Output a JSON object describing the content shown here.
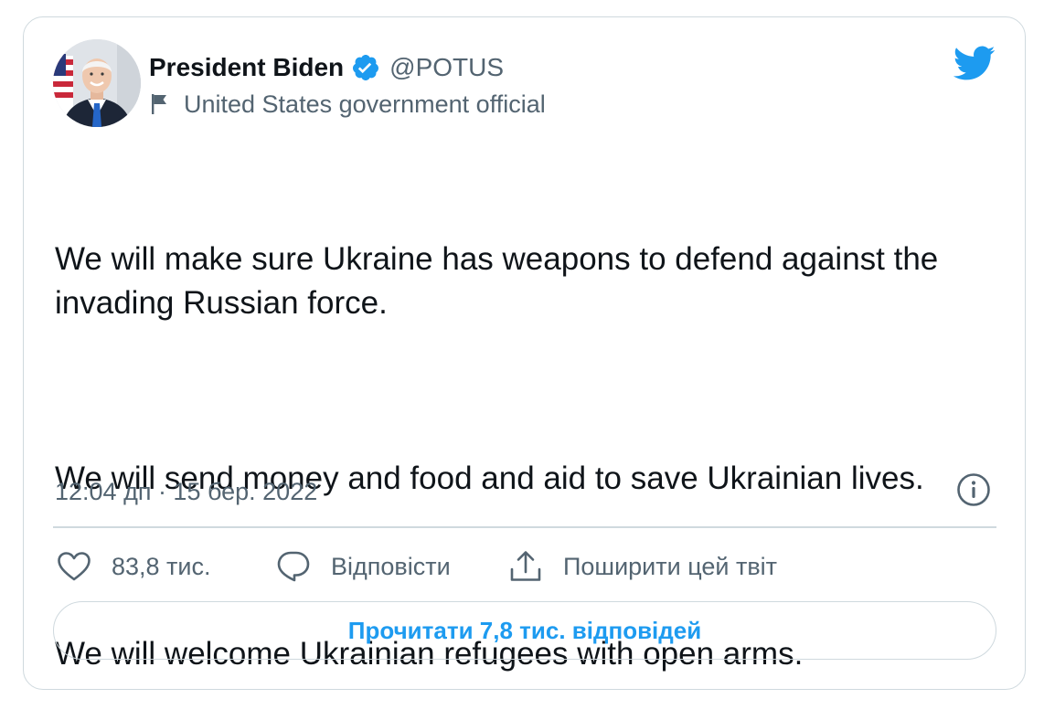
{
  "author": {
    "display_name": "President Biden",
    "handle": "@POTUS",
    "label": "United States government official",
    "avatar_icon": "avatar-photo",
    "verified_icon": "verified-badge-icon",
    "label_icon": "flag-icon"
  },
  "brand": {
    "logo_icon": "twitter-bird-icon",
    "accent_color": "#1d9bf0"
  },
  "tweet": {
    "paragraphs": [
      "We will make sure Ukraine has weapons to defend against the invading Russian force.",
      "We will send money and food and aid to save Ukrainian lives.",
      "We will welcome Ukrainian refugees with open arms."
    ],
    "timestamp": "12:04 дп · 15 бер. 2022"
  },
  "actions": {
    "like": {
      "icon": "heart-icon",
      "label": "83,8 тис."
    },
    "reply": {
      "icon": "speech-bubble-icon",
      "label": "Відповісти"
    },
    "share": {
      "icon": "share-icon",
      "label": "Поширити цей твіт"
    },
    "info_icon": "info-icon"
  },
  "footer": {
    "read_replies_label": "Прочитати 7,8 тис. відповідей"
  },
  "colors": {
    "text_primary": "#0f1419",
    "text_secondary": "#536471",
    "border": "#cfd9de"
  }
}
